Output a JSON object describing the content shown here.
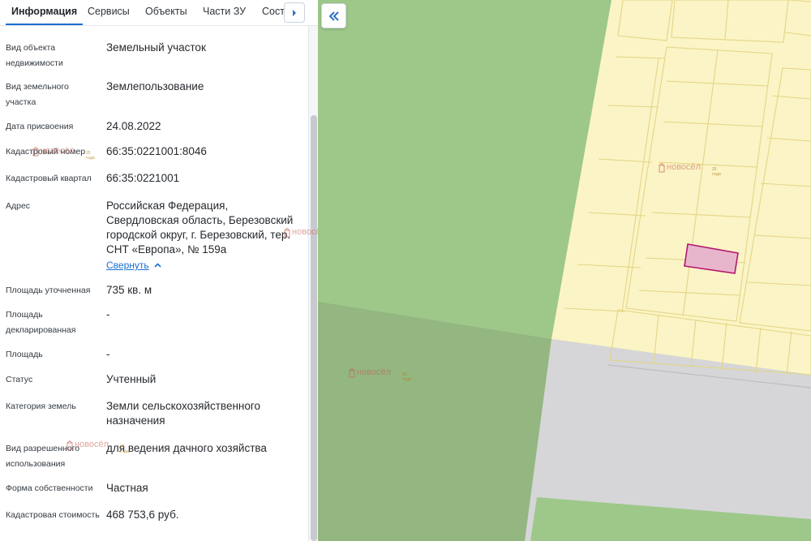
{
  "tabs": [
    {
      "label": "Информация",
      "active": true
    },
    {
      "label": "Сервисы"
    },
    {
      "label": "Объекты"
    },
    {
      "label": "Части ЗУ"
    },
    {
      "label": "Соста"
    }
  ],
  "fields": [
    {
      "label": "Вид объекта недвижимости",
      "value": "Земельный участок"
    },
    {
      "label": "Вид земельного участка",
      "value": "Землепользование"
    },
    {
      "label": "Дата присвоения",
      "value": "24.08.2022"
    },
    {
      "label": "Кадастровый номер",
      "value": "66:35:0221001:8046"
    },
    {
      "label": "Кадастровый квартал",
      "value": "66:35:0221001"
    },
    {
      "label": "Адрес",
      "value": "Российская Федерация, Свердловская область, Березовский городской округ, г. Березовский, тер. СНТ «Европа», № 159а"
    },
    {
      "label": "Площадь уточненная",
      "value": "735 кв. м"
    },
    {
      "label": "Площадь декларированная",
      "value": "-"
    },
    {
      "label": "Площадь",
      "value": "-"
    },
    {
      "label": "Статус",
      "value": "Учтенный"
    },
    {
      "label": "Категория земель",
      "value": "Земли сельскохозяйственного назначения"
    },
    {
      "label": "Вид разрешенного использования",
      "value": "для ведения дачного хозяйства"
    },
    {
      "label": "Форма собственности",
      "value": "Частная"
    },
    {
      "label": "Кадастровая стоимость",
      "value": "468 753,6 руб."
    }
  ],
  "address_collapse_label": "Свернуть",
  "icons": {
    "tab_next": "chevron-right-icon",
    "map_collapse": "double-chevron-left-icon",
    "collapse": "chevron-up-icon"
  },
  "watermark": {
    "name": "новосёл",
    "years": "25 года"
  },
  "colors": {
    "accent": "#1b6fd1",
    "map_green": "#9bc487",
    "map_yellow": "#fbf4c8",
    "parcel_outline": "#c2185b",
    "parcel_fill": "#e8b6cc"
  }
}
